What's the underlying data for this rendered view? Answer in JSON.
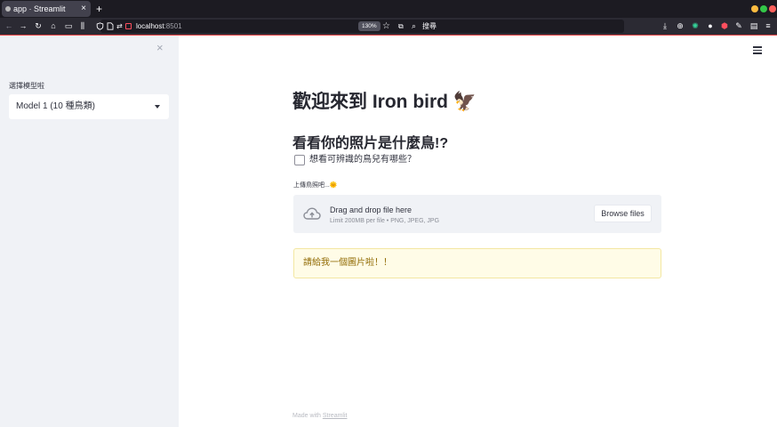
{
  "browser": {
    "tab_title": "app · Streamlit",
    "url_host": "localhost",
    "url_port": ":8501",
    "zoom": "130%",
    "search_placeholder": "搜尋",
    "new_tab": "+",
    "close_tab": "×"
  },
  "sidebar": {
    "close": "×",
    "select_label": "選擇模型啦",
    "select_value": "Model 1 (10 種鳥類)"
  },
  "main": {
    "title": "歡迎來到 Iron bird 🦅",
    "subtitle": "看看你的照片是什麼鳥!?",
    "checkbox_label": "想看可辨識的鳥兒有哪些？",
    "upload_label": "上傳鳥照吧...🌞",
    "dropzone_text": "Drag and drop file here",
    "dropzone_limit": "Limit 200MB per file • PNG, JPEG, JPG",
    "browse_button": "Browse files",
    "warning": "請給我一個圖片啦！！"
  },
  "footer": {
    "made_with": "Made with ",
    "link": "Streamlit"
  },
  "colors": {
    "accent": "#ff4b4b",
    "sidebar_bg": "#f0f2f6",
    "warning_bg": "#fffce7",
    "warning_text": "#926c05"
  }
}
